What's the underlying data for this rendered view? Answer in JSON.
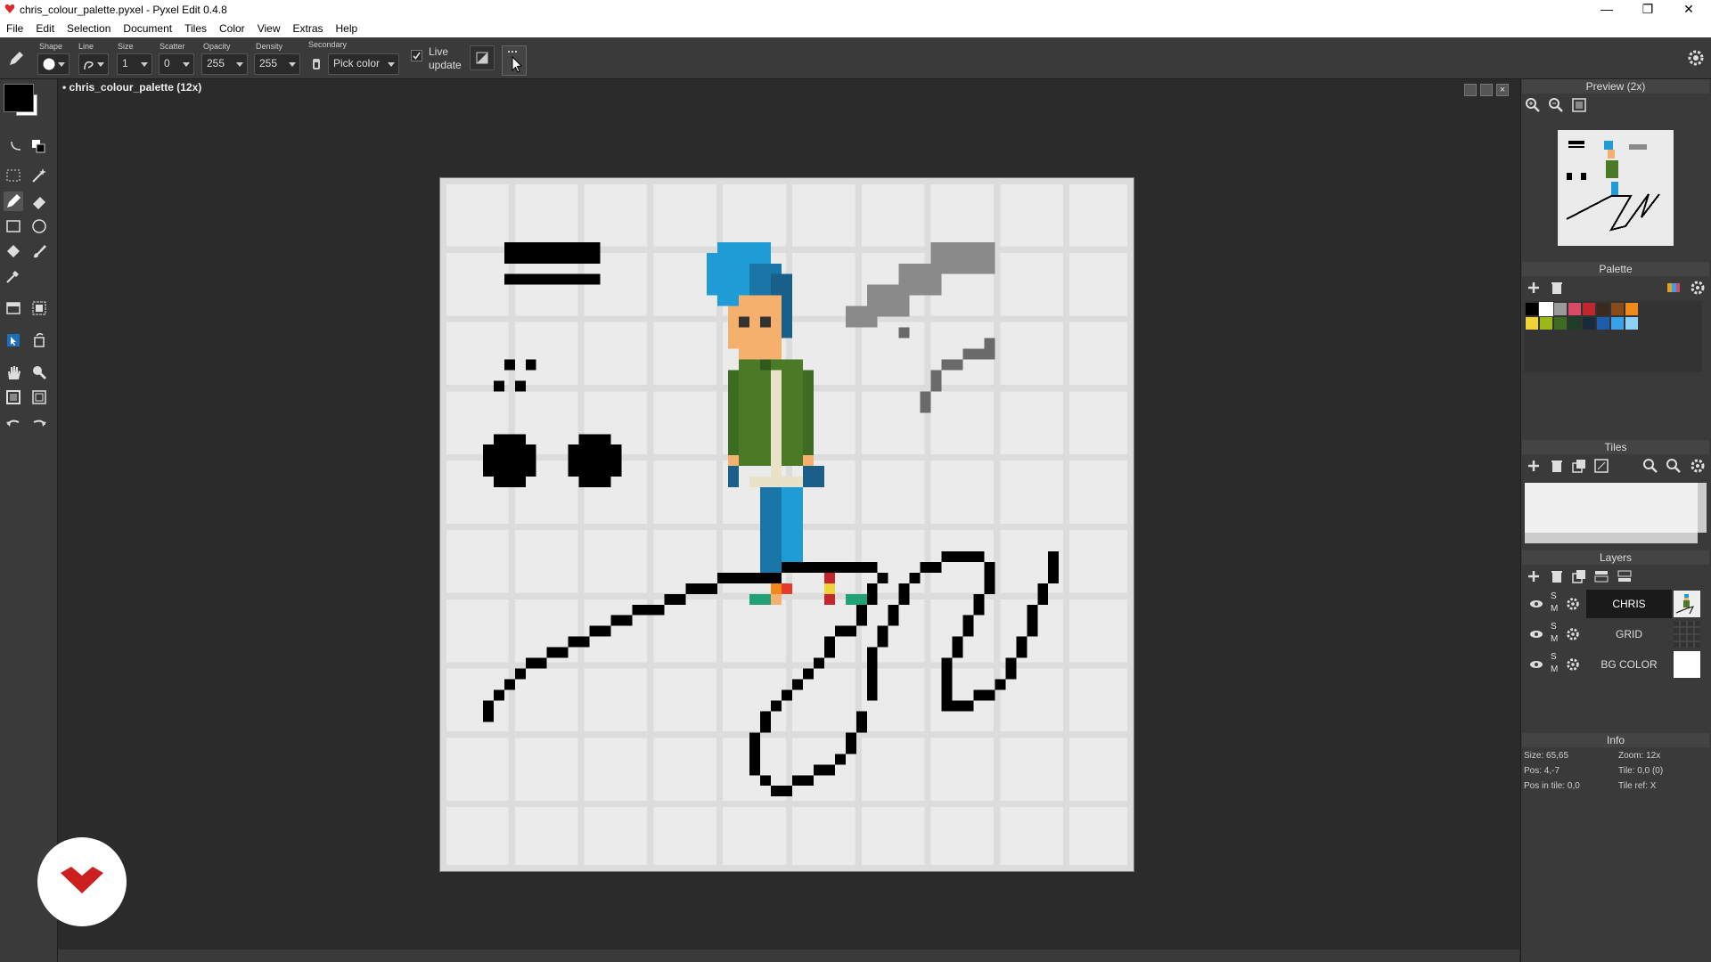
{
  "window": {
    "title": "chris_colour_palette.pyxel - Pyxel Edit 0.4.8",
    "controls": [
      "—",
      "❐",
      "✕"
    ]
  },
  "menu": [
    "File",
    "Edit",
    "Selection",
    "Document",
    "Tiles",
    "Color",
    "View",
    "Extras",
    "Help"
  ],
  "toolbar": {
    "shape_label": "Shape",
    "line_label": "Line",
    "size_label": "Size",
    "size_value": "1",
    "scatter_label": "Scatter",
    "scatter_value": "0",
    "opacity_label": "Opacity",
    "opacity_value": "255",
    "density_label": "Density",
    "density_value": "255",
    "secondary_label": "Secondary",
    "secondary_value": "Pick color",
    "live_update_line1": "Live",
    "live_update_line2": "update"
  },
  "document": {
    "tab_title": "• chris_colour_palette   (12x)"
  },
  "panels": {
    "preview": {
      "title": "Preview (2x)"
    },
    "palette": {
      "title": "Palette",
      "colors": [
        "#000000",
        "#ffffff",
        "#9a9a9a",
        "#d64b66",
        "#c1272d",
        "#3b2a1f",
        "#8a4b1a",
        "#ef8a1a",
        "#f0d33a",
        "#9bb81a",
        "#3e6b22",
        "#1f3c2a",
        "#1a2a3a",
        "#1e5ca8",
        "#3aa0e8",
        "#8ecff5"
      ]
    },
    "tiles": {
      "title": "Tiles"
    },
    "layers": {
      "title": "Layers",
      "items": [
        {
          "name": "CHRIS",
          "s": "S",
          "m": "M",
          "selected": true
        },
        {
          "name": "GRID",
          "s": "S",
          "m": "M",
          "selected": false
        },
        {
          "name": "BG COLOR",
          "s": "S",
          "m": "M",
          "selected": false
        }
      ]
    },
    "info": {
      "title": "Info",
      "size": "Size: 65,65",
      "zoom": "Zoom: 12x",
      "pos": "Pos: 4,-7",
      "tile": "Tile: 0,0 (0)",
      "pos_in_tile": "Pos in tile: 0,0",
      "tile_ref": "Tile ref: X"
    }
  },
  "colors": {
    "chrome": "#3a3a3a",
    "workspace": "#2b2b2b",
    "canvas_bg": "#ebebeb",
    "hair": "#1f9bd6",
    "jacket": "#4a7a26",
    "skin": "#f5b06e"
  }
}
